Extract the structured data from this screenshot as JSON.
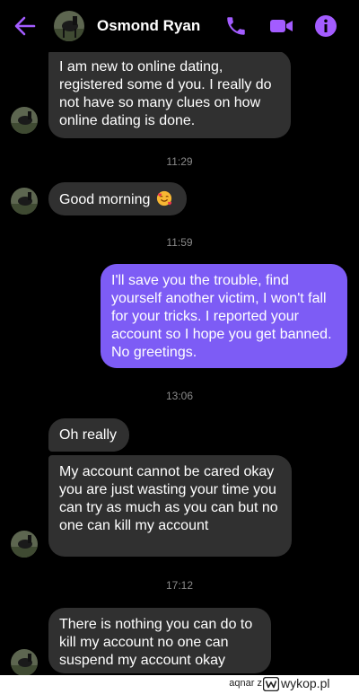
{
  "header": {
    "contact_name": "Osmond Ryan"
  },
  "messages": [
    {
      "side": "in",
      "text": "I am new to online dating, registered some d you. I really do not have so many clues on how online dating is done."
    },
    {
      "time": "11:29"
    },
    {
      "side": "in",
      "text": "Good morning"
    },
    {
      "time": "11:59"
    },
    {
      "side": "out",
      "text": "I'll save you the trouble, find yourself another victim, I won't fall for your tricks. I reported your account so I hope you get banned. No greetings."
    },
    {
      "time": "13:06"
    },
    {
      "side": "in",
      "text": "Oh really"
    },
    {
      "side": "in",
      "text": "My account cannot be cared okay you are just wasting your time you can try as much as you can but no one can kill my account"
    },
    {
      "time": "17:12"
    },
    {
      "side": "in",
      "text": "There is nothing you can do to kill my account no one can suspend my account okay"
    }
  ],
  "emoji": "smiling-face-with-hearts",
  "colors": {
    "accent": "#a35cff",
    "outgoing_bubble": "#7d5cf5",
    "incoming_bubble": "#303030",
    "background": "#000000"
  },
  "watermark": {
    "user": "aqnar z",
    "site": "wykop.pl"
  }
}
